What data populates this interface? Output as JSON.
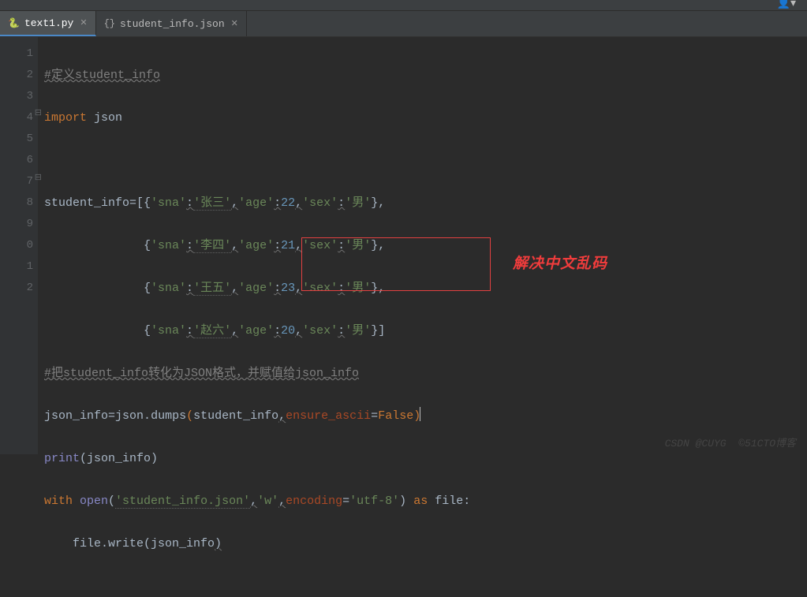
{
  "tabs": [
    {
      "label": "text1.py",
      "active": true,
      "icon": "python-icon"
    },
    {
      "label": "student_info.json",
      "active": false,
      "icon": "json-icon"
    }
  ],
  "gutter_fold_markers": [
    {
      "line": 4,
      "glyph": "⊟"
    },
    {
      "line": 7,
      "glyph": "⊟"
    }
  ],
  "line_numbers": [
    "1",
    "2",
    "3",
    "4",
    "5",
    "6",
    "7",
    "8",
    "9",
    "0",
    "1",
    "2"
  ],
  "code": {
    "l1_comment": "#定义student_info",
    "l2_kw": "import ",
    "l2_mod": "json",
    "l4_a": "student_info=[{",
    "key_sna": "'sna'",
    "key_age": "'age'",
    "key_sex": "'sex'",
    "val_name1": "'张三'",
    "val_name2": "'李四'",
    "val_name3": "'王五'",
    "val_name4": "'赵六'",
    "age1": "22",
    "age2": "21",
    "age3": "23",
    "age4": "20",
    "val_sex": "'男'",
    "indent": "              {",
    "l8_comment": "#把student_info转化为JSON格式，并赋值给json_info",
    "l9_var": "json_info",
    "eq": "=",
    "l9_mod": "json",
    "dot": ".",
    "l9_fn": "dumps",
    "lp": "(",
    "rp": ")",
    "l9_arg": "student_info",
    "l9_kwarg": "ensure_ascii",
    "l9_false": "False",
    "l10_print": "print",
    "l11_with": "with ",
    "l11_open": "open",
    "l11_file": "'student_info.json'",
    "l11_mode": "'w'",
    "l11_enc_k": "encoding",
    "l11_enc_v": "'utf-8'",
    "l11_as": " as ",
    "l11_name": "file:",
    "l12_indent": "    file.write(json_info",
    "comma": ","
  },
  "annotation": "解决中文乱码",
  "watermark": "©51CTO博客",
  "watermark2": "CSDN @CUYG"
}
